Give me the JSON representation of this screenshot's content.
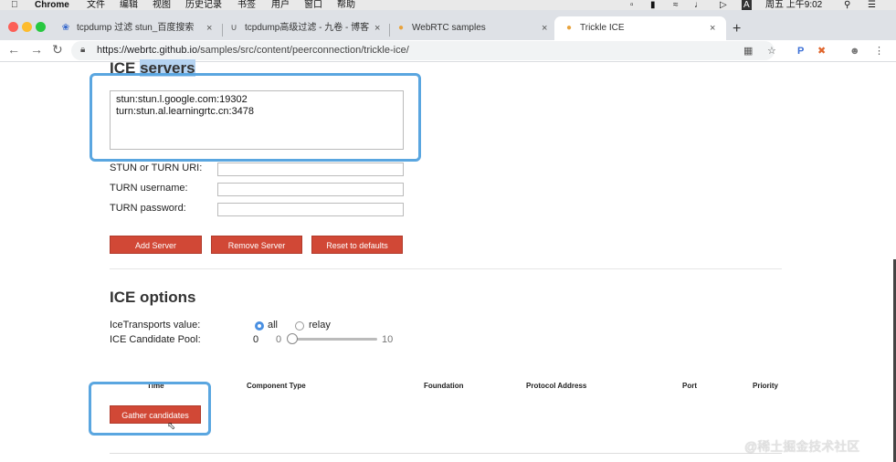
{
  "menubar": {
    "app": "Chrome",
    "items": [
      "文件",
      "编辑",
      "视图",
      "历史记录",
      "书签",
      "用户",
      "窗口",
      "帮助"
    ],
    "clock": "周五 上午9:02",
    "input_method": "A"
  },
  "tabs": [
    {
      "title": "tcpdump 过滤 stun_百度搜索",
      "close": "×"
    },
    {
      "title": "tcpdump高级过滤 - 九卷 - 博客",
      "close": "×"
    },
    {
      "title": "WebRTC samples",
      "close": "×"
    },
    {
      "title": "Trickle ICE",
      "close": "×",
      "active": true
    }
  ],
  "new_tab": "+",
  "toolbar": {
    "url_host": "https://webrtc.github.io",
    "url_path": "/samples/src/content/peerconnection/trickle-ice/",
    "profile_letter": "P"
  },
  "ice_servers": {
    "title_plain": "ICE ",
    "title_selected": "servers",
    "servers": "stun:stun.l.google.com:19302\nturn:stun.al.learningrtc.cn:3478",
    "uri_label": "STUN or TURN URI:",
    "username_label": "TURN username:",
    "password_label": "TURN password:",
    "add_button": "Add Server",
    "remove_button": "Remove Server",
    "reset_button": "Reset to defaults"
  },
  "ice_options": {
    "title": "ICE options",
    "transports_label": "IceTransports value:",
    "option_all": "all",
    "option_relay": "relay",
    "selected_transport": "all",
    "pool_label": "ICE Candidate Pool:",
    "pool_value": "0",
    "slider_min": "0",
    "slider_max": "10",
    "slider_value": 0
  },
  "candidates": {
    "columns": [
      "Time",
      "Component Type",
      "Foundation",
      "Protocol Address",
      "Port",
      "Priority"
    ],
    "gather_button": "Gather candidates"
  },
  "watermark": "@稀土掘金技术社区",
  "colors": {
    "button_bg": "#d14836",
    "highlight_border": "#5aa6e0",
    "radio_selected": "#4a90e2"
  }
}
